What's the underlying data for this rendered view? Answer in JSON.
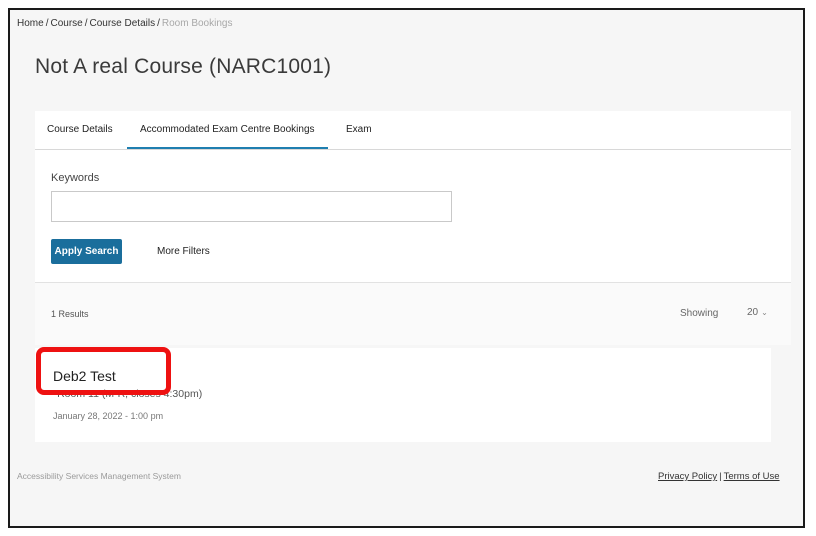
{
  "breadcrumb": {
    "items": [
      "Home",
      "Course",
      "Course Details"
    ],
    "current": "Room Bookings",
    "separator": "/"
  },
  "page": {
    "title": "Not A real Course (NARC1001)"
  },
  "tabs": [
    {
      "label": "Course Details",
      "active": false
    },
    {
      "label": "Accommodated Exam Centre Bookings",
      "active": true
    },
    {
      "label": "Exam",
      "active": false
    }
  ],
  "search": {
    "keywords_label": "Keywords",
    "keywords_value": "",
    "keywords_placeholder": "",
    "apply_label": "Apply Search",
    "more_filters_label": "More Filters"
  },
  "results": {
    "count_text": "1 Results",
    "showing_label": "Showing",
    "page_size": "20",
    "items": [
      {
        "title": "Deb2 Test",
        "room": "*Room 11 (M-R, closes 4:30pm)",
        "datetime": "January 28, 2022 - 1:00 pm"
      }
    ]
  },
  "footer": {
    "brand": "Accessibility Services Management System",
    "privacy": "Privacy Policy",
    "separator": "|",
    "terms": "Terms of Use"
  },
  "colors": {
    "accent": "#1a6e9c",
    "tab_underline": "#1f7fb0",
    "highlight": "#ee1111",
    "background": "#f6f6f6"
  }
}
